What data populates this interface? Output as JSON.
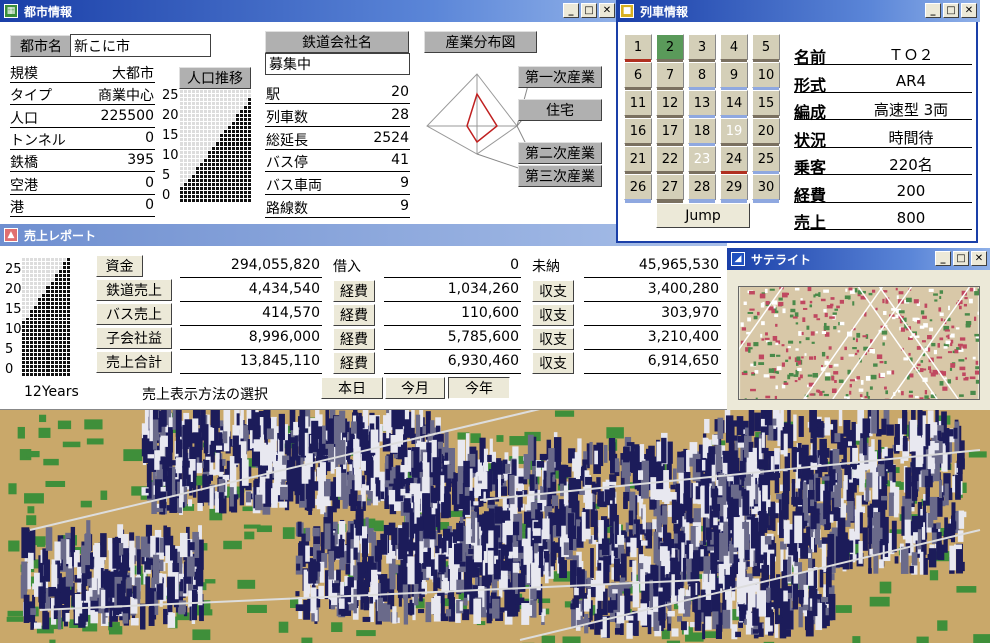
{
  "city_window": {
    "title": "都市情報",
    "city_name_label": "都市名",
    "city_name": "新こに市",
    "rows": [
      {
        "label": "規模",
        "value": "大都市"
      },
      {
        "label": "タイプ",
        "value": "商業中心"
      },
      {
        "label": "人口",
        "value": "225500"
      },
      {
        "label": "トンネル",
        "value": "0"
      },
      {
        "label": "鉄橋",
        "value": "395"
      },
      {
        "label": "空港",
        "value": "0"
      },
      {
        "label": "港",
        "value": "0"
      }
    ],
    "pop_trend_label": "人口推移",
    "pop_ticks": [
      "25",
      "20",
      "15",
      "10",
      "5",
      "0"
    ],
    "railway_label": "鉄道会社名",
    "railway_value": "募集中",
    "stats": [
      {
        "label": "駅",
        "value": "20"
      },
      {
        "label": "列車数",
        "value": "28"
      },
      {
        "label": "総延長",
        "value": "2524"
      },
      {
        "label": "バス停",
        "value": "41"
      },
      {
        "label": "バス車両",
        "value": "9"
      },
      {
        "label": "路線数",
        "value": "9"
      }
    ],
    "industry_label": "産業分布図",
    "industry": [
      "第一次産業",
      "住宅",
      "第二次産業",
      "第三次産業"
    ]
  },
  "train_window": {
    "title": "列車情報",
    "numbers": [
      "1",
      "2",
      "3",
      "4",
      "5",
      "6",
      "7",
      "8",
      "9",
      "10",
      "11",
      "12",
      "13",
      "14",
      "15",
      "16",
      "17",
      "18",
      "19",
      "20",
      "21",
      "22",
      "23",
      "24",
      "25",
      "26",
      "27",
      "28",
      "29",
      "30"
    ],
    "jump": "Jump",
    "info": [
      {
        "label": "名前",
        "value": "ＴＯ２"
      },
      {
        "label": "形式",
        "value": "AR4"
      },
      {
        "label": "編成",
        "value": "高速型 3両"
      },
      {
        "label": "状況",
        "value": "時間待"
      },
      {
        "label": "乗客",
        "value": "220名"
      },
      {
        "label": "経費",
        "value": "200"
      },
      {
        "label": "売上",
        "value": "800"
      }
    ]
  },
  "sales_window": {
    "title": "売上レポート",
    "chart_ticks": [
      "25",
      "20",
      "15",
      "10",
      "5",
      "0"
    ],
    "years": "12Years",
    "rows": [
      {
        "btn": "資金",
        "v1": "294,055,820",
        "mid": "借入",
        "v2": "0",
        "right": "未納",
        "v3": "45,965,530"
      },
      {
        "btn": "鉄道売上",
        "v1": "4,434,540",
        "mid": "経費",
        "v2": "1,034,260",
        "right": "収支",
        "v3": "3,400,280"
      },
      {
        "btn": "バス売上",
        "v1": "414,570",
        "mid": "経費",
        "v2": "110,600",
        "right": "収支",
        "v3": "303,970"
      },
      {
        "btn": "子会社益",
        "v1": "8,996,000",
        "mid": "経費",
        "v2": "5,785,600",
        "right": "収支",
        "v3": "3,210,400"
      },
      {
        "btn": "売上合計",
        "v1": "13,845,110",
        "mid": "経費",
        "v2": "6,930,460",
        "right": "収支",
        "v3": "6,914,650"
      }
    ],
    "display_method": "売上表示方法の選択",
    "periods": [
      "本日",
      "今月",
      "今年"
    ]
  },
  "satellite_window": {
    "title": "サテライト"
  },
  "colors": {
    "title_bar": "#1a3fa8",
    "button_gray": "#b0b0b0",
    "terrain": "#c9a86a",
    "grass": "#3f8f3a"
  }
}
